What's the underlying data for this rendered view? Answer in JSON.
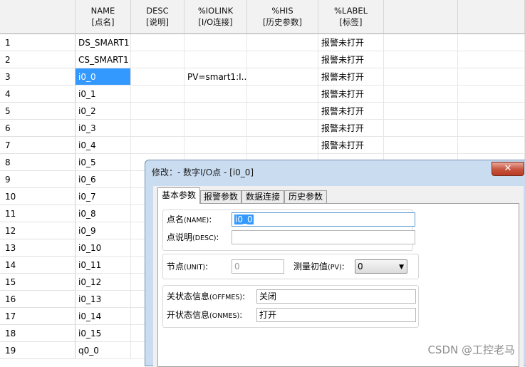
{
  "grid": {
    "columns": [
      {
        "line1": "NAME",
        "line2": "[点名]"
      },
      {
        "line1": "DESC",
        "line2": "[说明]"
      },
      {
        "line1": "%IOLINK",
        "line2": "[I/O连接]"
      },
      {
        "line1": "%HIS",
        "line2": "[历史参数]"
      },
      {
        "line1": "%LABEL",
        "line2": "[标签]"
      }
    ],
    "rows": [
      {
        "num": "1",
        "name": "DS_SMART1",
        "iolink": "",
        "label": "报警未打开"
      },
      {
        "num": "2",
        "name": "CS_SMART1",
        "iolink": "",
        "label": "报警未打开"
      },
      {
        "num": "3",
        "name": "i0_0",
        "iolink": "PV=smart1:I...",
        "label": "报警未打开"
      },
      {
        "num": "4",
        "name": "i0_1",
        "iolink": "",
        "label": "报警未打开"
      },
      {
        "num": "5",
        "name": "i0_2",
        "iolink": "",
        "label": "报警未打开"
      },
      {
        "num": "6",
        "name": "i0_3",
        "iolink": "",
        "label": "报警未打开"
      },
      {
        "num": "7",
        "name": "i0_4",
        "iolink": "",
        "label": "报警未打开"
      },
      {
        "num": "8",
        "name": "i0_5",
        "iolink": "",
        "label": ""
      },
      {
        "num": "9",
        "name": "i0_6",
        "iolink": "",
        "label": ""
      },
      {
        "num": "10",
        "name": "i0_7",
        "iolink": "",
        "label": ""
      },
      {
        "num": "11",
        "name": "i0_8",
        "iolink": "",
        "label": ""
      },
      {
        "num": "12",
        "name": "i0_9",
        "iolink": "",
        "label": ""
      },
      {
        "num": "13",
        "name": "i0_10",
        "iolink": "",
        "label": ""
      },
      {
        "num": "14",
        "name": "i0_11",
        "iolink": "",
        "label": ""
      },
      {
        "num": "15",
        "name": "i0_12",
        "iolink": "",
        "label": ""
      },
      {
        "num": "16",
        "name": "i0_13",
        "iolink": "",
        "label": ""
      },
      {
        "num": "17",
        "name": "i0_14",
        "iolink": "",
        "label": ""
      },
      {
        "num": "18",
        "name": "i0_15",
        "iolink": "",
        "label": ""
      },
      {
        "num": "19",
        "name": "q0_0",
        "iolink": "",
        "label": ""
      }
    ],
    "selected_row": "3"
  },
  "dialog": {
    "title": "修改：- 数字I/O点 - [i0_0]",
    "close_symbol": "✕",
    "tabs": [
      "基本参数",
      "报警参数",
      "数据连接",
      "历史参数"
    ],
    "active_tab": "基本参数",
    "fields": {
      "name_label": "点名",
      "name_code": "(NAME)",
      "name_value": "i0_0",
      "desc_label": "点说明",
      "desc_code": "(DESC)",
      "desc_value": "",
      "unit_label": "节点",
      "unit_code": "(UNIT)",
      "unit_value": "0",
      "pv_label": "测量初值",
      "pv_code": "(PV)",
      "pv_value": "0",
      "offmes_label": "关状态信息",
      "offmes_code": "(OFFMES)",
      "offmes_value": "关闭",
      "onmes_label": "开状态信息",
      "onmes_code": "(ONMES)",
      "onmes_value": "打开"
    }
  },
  "watermark": "CSDN @工控老马"
}
